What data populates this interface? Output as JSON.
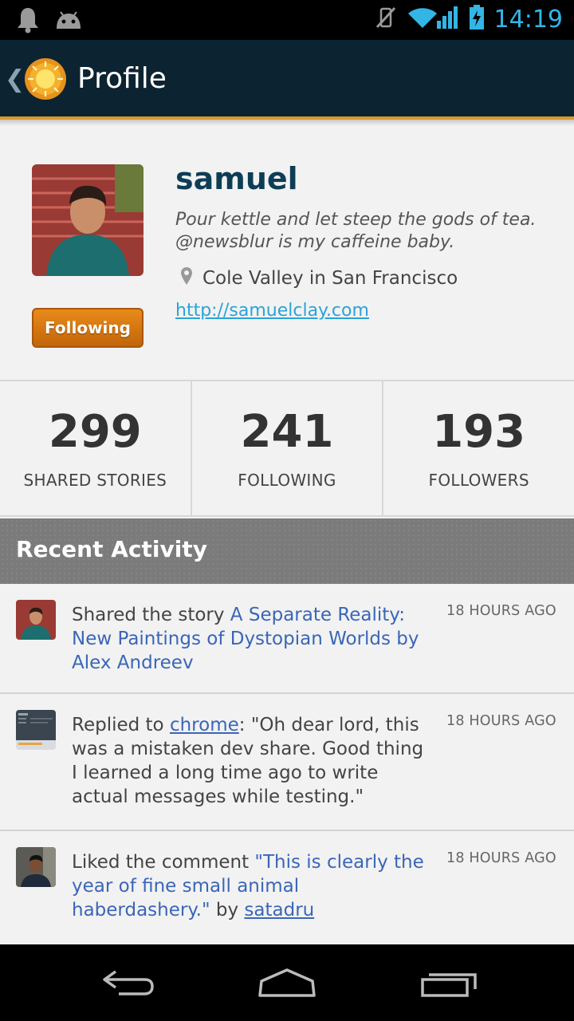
{
  "status_bar": {
    "time": "14:19",
    "icons": [
      "notification-bell-icon",
      "android-icon",
      "vibrate-mute-icon",
      "wifi-icon",
      "signal-icon",
      "battery-charging-icon"
    ]
  },
  "action_bar": {
    "title": "Profile",
    "back_glyph": "❮",
    "logo_icon": "newsblur-sun-icon"
  },
  "profile": {
    "username": "samuel",
    "bio": "Pour kettle and let steep the gods of tea. @newsblur is my caffeine baby.",
    "location": "Cole Valley in San Francisco",
    "website": "http://samuelclay.com",
    "follow_button": "Following"
  },
  "stats": [
    {
      "value": "299",
      "label": "SHARED STORIES"
    },
    {
      "value": "241",
      "label": "FOLLOWING"
    },
    {
      "value": "193",
      "label": "FOLLOWERS"
    }
  ],
  "recent_activity": {
    "title": "Recent Activity",
    "items": [
      {
        "prefix": "Shared the story ",
        "link": "A Separate Reality: New Paintings of Dystopian Worlds by Alex Andreev",
        "time": "18 HOURS AGO"
      },
      {
        "prefix": "Replied to ",
        "link": "chrome",
        "suffix": ": \"Oh dear lord, this was a mistaken dev share. Good thing I learned a long time ago to write actual messages while testing.\"",
        "time": "18 HOURS AGO"
      },
      {
        "prefix": "Liked the comment ",
        "link": "\"This is clearly the year of fine small animal haberdashery.\"",
        "middle": " by ",
        "user": "satadru",
        "time": "18 HOURS AGO"
      }
    ]
  },
  "colors": {
    "action_bar_bg": "#0c2331",
    "accent_orange": "#d79a28",
    "username": "#0e3e56",
    "link": "#3a66b8",
    "website_link": "#2aa3d8",
    "status_time": "#33b5e5"
  },
  "nav_bar": {
    "icons": [
      "back-icon",
      "home-icon",
      "recent-apps-icon"
    ]
  }
}
